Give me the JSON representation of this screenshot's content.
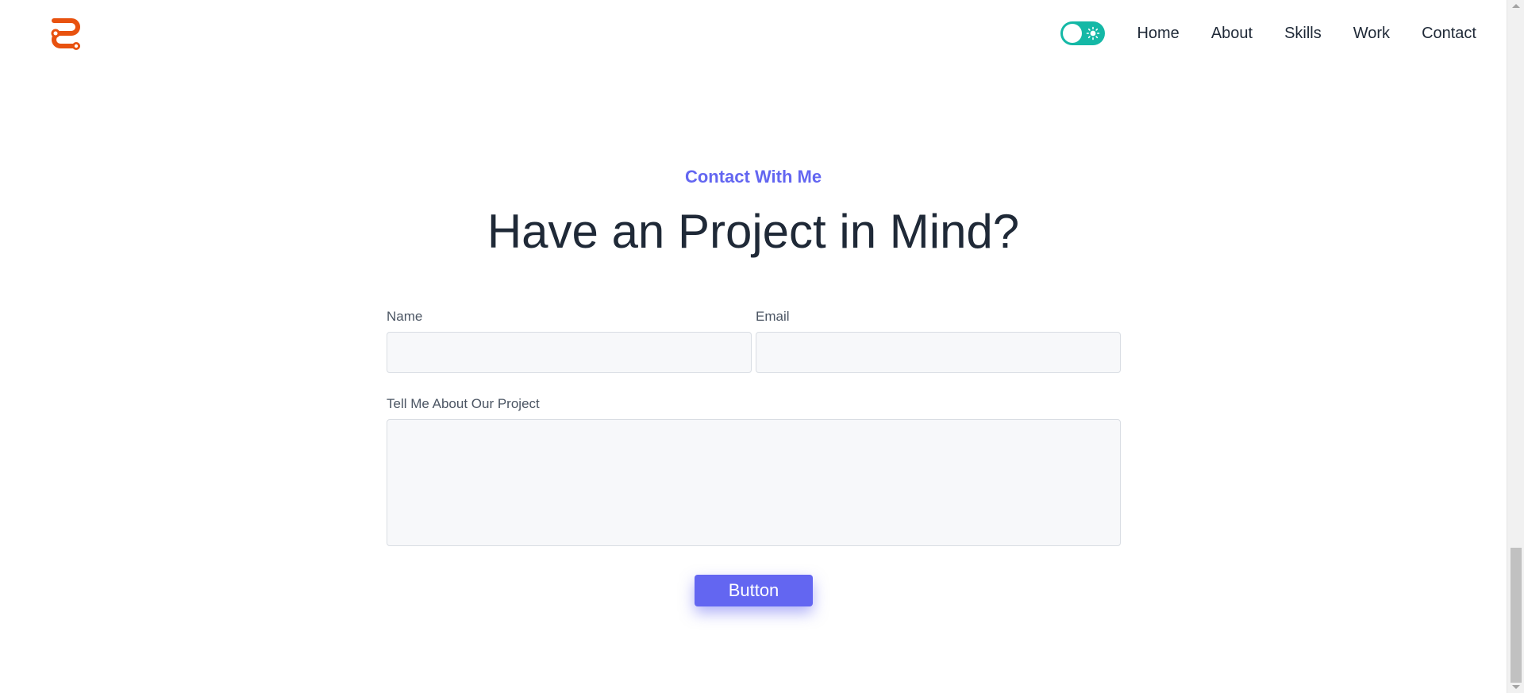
{
  "header": {
    "logo_icon": "s-logo-icon",
    "theme_toggle": {
      "icon": "sun-icon",
      "state": "on"
    },
    "nav": [
      {
        "label": "Home"
      },
      {
        "label": "About"
      },
      {
        "label": "Skills"
      },
      {
        "label": "Work"
      },
      {
        "label": "Contact"
      }
    ]
  },
  "contact": {
    "eyebrow": "Contact With Me",
    "title": "Have an Project in Mind?",
    "form": {
      "name_label": "Name",
      "name_value": "",
      "email_label": "Email",
      "email_value": "",
      "message_label": "Tell Me About Our Project",
      "message_value": "",
      "submit_label": "Button"
    }
  },
  "colors": {
    "brand_orange": "#e8520f",
    "accent_indigo": "#6366f1",
    "toggle_teal": "#14b8a6"
  }
}
